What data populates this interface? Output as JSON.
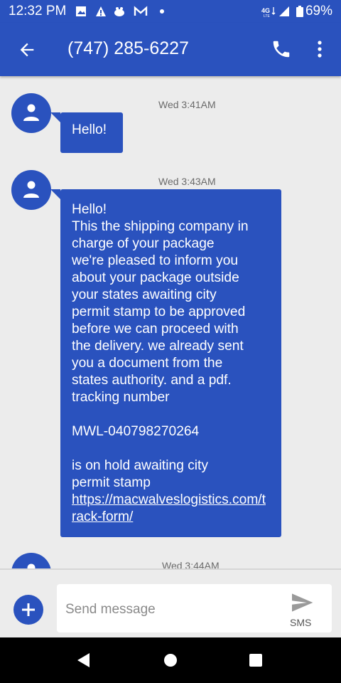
{
  "status_bar": {
    "time": "12:32 PM",
    "network": "4G LTE",
    "battery": "69%"
  },
  "header": {
    "contact": "(747) 285-6227"
  },
  "messages": [
    {
      "timestamp": "Wed 3:41AM",
      "text": "Hello!"
    },
    {
      "timestamp": "Wed 3:43AM",
      "lines": [
        "Hello!",
        "This the shipping company in",
        "charge of your package",
        "we're pleased to inform you",
        "about your package outside",
        "your states awaiting city",
        "permit stamp to be approved",
        "before we can proceed with",
        "the delivery. we already sent",
        "you a document from the",
        "states authority. and a pdf.",
        "tracking number"
      ],
      "tracking": "MWL-040798270264",
      "lines2": [
        "is on hold awaiting city",
        "permit stamp"
      ],
      "link": "https://macwalveslogistics.com/track-form/"
    },
    {
      "timestamp": "Wed 3:44AM"
    }
  ],
  "composer": {
    "placeholder": "Send message",
    "send_label": "SMS"
  },
  "colors": {
    "accent": "#2a52be",
    "background": "#ececec"
  }
}
